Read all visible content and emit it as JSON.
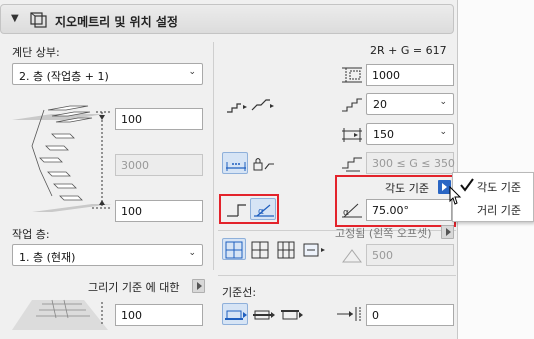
{
  "header": {
    "title": "지오메트리 및 위치 설정"
  },
  "left": {
    "stair_top_label": "계단 상부:",
    "stair_top_value": "2. 층 (작업층 + 1)",
    "height_top": "100",
    "height_total": "3000",
    "height_bottom": "100",
    "home_story_label": "작업 층:",
    "home_story_value": "1. 층 (현재)",
    "drawing_ref_label": "그리기 기준 에 대한",
    "drawing_ref_value": "100"
  },
  "right": {
    "formula": "2R + G = 617",
    "flight_height": "1000",
    "riser_count": "20",
    "tread_depth": "150",
    "going_range": "300 ≤ G ≤ 350",
    "angle_ref_label": "각도 기준",
    "angle_value": "75.00°",
    "anchor_label": "고정됨 (왼쪽 오프셋)",
    "anchor_value": "500",
    "baseline_label": "기준선:",
    "offset_value": "0"
  },
  "popup": {
    "items": [
      {
        "label": "각도 기준",
        "checked": true
      },
      {
        "label": "거리 기준",
        "checked": false
      }
    ]
  },
  "colors": {
    "accent": "#2a66c4",
    "highlight_box": "#e3232b"
  }
}
